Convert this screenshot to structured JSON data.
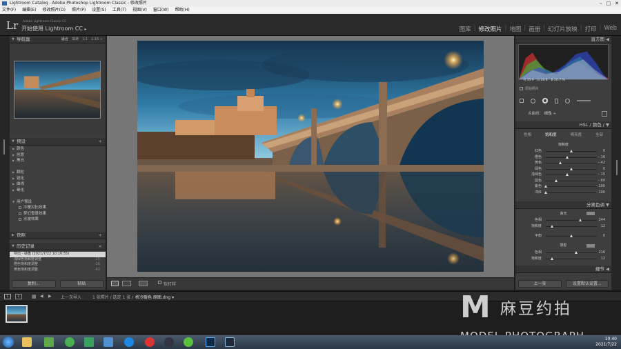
{
  "window": {
    "title": "Lightroom Catalog - Adobe Photoshop Lightroom Classic - 修改照片",
    "controls": [
      "–",
      "□",
      "✕"
    ]
  },
  "menu": [
    "文件(F)",
    "编辑(E)",
    "修改照片(D)",
    "照片(P)",
    "设置(S)",
    "工具(T)",
    "视图(V)",
    "窗口(W)",
    "帮助(H)"
  ],
  "identity": {
    "logo": "Lr",
    "product": "Adobe Lightroom Classic CC",
    "line": "开始使用 Lightroom CC",
    "arrow": "▸"
  },
  "modules": [
    "图库",
    "修改照片",
    "地图",
    "画册",
    "幻灯片放映",
    "打印",
    "Web"
  ],
  "module_sep": "|",
  "active_module": "修改照片",
  "left": {
    "navigator": {
      "title": "导航器",
      "opts": [
        "适合",
        "填满",
        "1:1",
        "1:16 ÷"
      ]
    },
    "presets": {
      "title": "预设",
      "items": [
        "颜色",
        "创意",
        "黑白",
        "",
        "颗粒",
        "锐化",
        "曲线",
        "晕化"
      ]
    },
    "user_presets": {
      "title": "用户预设",
      "items": [
        "冷暖对比效果",
        "梦幻雪景效果",
        "水波效果"
      ]
    },
    "snapshots": {
      "title": "快照"
    },
    "history": {
      "title": "历史记录",
      "close": "×",
      "items": [
        {
          "label": "导出 - 硬盘 (2021/7/22 10:16:55)",
          "num": ""
        },
        {
          "label": "浅绿色饱和度调整",
          "num": "-15"
        },
        {
          "label": "橙色饱和度调整",
          "num": "-16"
        },
        {
          "label": "黄色饱和度调整",
          "num": "-42"
        }
      ]
    },
    "copy": "复制...",
    "paste": "粘贴"
  },
  "toolbar": {
    "softproof": "软打样",
    "softproof_value": "0"
  },
  "right": {
    "histogram": {
      "title": "直方图",
      "r": "R 35.9",
      "g": "G 28.6",
      "b": "B 20.7 %",
      "original": "原始照片"
    },
    "curve": {
      "label": "点曲线：",
      "value": "线性 ÷"
    },
    "hsl": {
      "title": "HSL / 颜色 /",
      "tabs": [
        "色相",
        "饱和度",
        "明亮度",
        "全部"
      ],
      "active": "饱和度",
      "section": "饱和度",
      "sliders": [
        {
          "label": "红色",
          "value": "0",
          "pos": 0.5
        },
        {
          "label": "橙色",
          "value": "– 16",
          "pos": 0.42
        },
        {
          "label": "黄色",
          "value": "– 42",
          "pos": 0.29
        },
        {
          "label": "绿色",
          "value": "0",
          "pos": 0.5
        },
        {
          "label": "浅绿色",
          "value": "– 15",
          "pos": 0.42
        },
        {
          "label": "蓝色",
          "value": "– 60",
          "pos": 0.2
        },
        {
          "label": "紫色",
          "value": "– 100",
          "pos": 0.0
        },
        {
          "label": "洋红",
          "value": "– 100",
          "pos": 0.0
        }
      ]
    },
    "split": {
      "title": "分离色调",
      "highlights": "高光",
      "shadows": "阴影",
      "balance": "平衡",
      "hl": [
        {
          "label": "色相",
          "value": "244",
          "pos": 0.68
        },
        {
          "label": "饱和度",
          "value": "12",
          "pos": 0.12
        }
      ],
      "bal": {
        "label": "平衡",
        "value": "0",
        "pos": 0.5
      },
      "sh": [
        {
          "label": "色相",
          "value": "216",
          "pos": 0.6
        },
        {
          "label": "饱和度",
          "value": "12",
          "pos": 0.12
        }
      ]
    },
    "detail": {
      "title": "细节"
    },
    "prev": "上一张",
    "reset": "设置默认设置..."
  },
  "filmbar": {
    "pages": [
      "1",
      "2"
    ],
    "source": "上一次导入",
    "count": "1 张照片 / 选定 1 张 /",
    "file": "桥冷暖色 原图.dng ▾"
  },
  "taskbar": {
    "time": "10:40",
    "date": "2021/7/22"
  },
  "watermark": {
    "cn": "麻豆约拍",
    "en": "MODEL PHOTOGRAPH"
  }
}
